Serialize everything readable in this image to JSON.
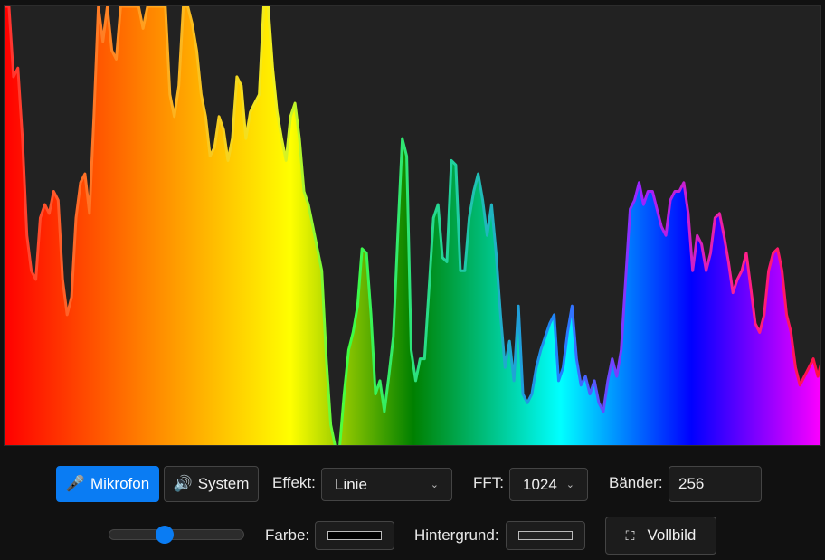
{
  "controls": {
    "mic_label": "Mikrofon",
    "system_label": "System",
    "effect_label": "Effekt:",
    "effect_value": "Linie",
    "fft_label": "FFT:",
    "fft_value": "1024",
    "bands_label": "Bänder:",
    "bands_value": "256",
    "color_label": "Farbe:",
    "background_label": "Hintergrund:",
    "fullscreen_label": "Vollbild",
    "volume_level": 0.4,
    "color_value": "#000000",
    "background_value": "#222222"
  },
  "colors": {
    "accent": "#0a7cf3",
    "panel_bg": "#222222",
    "page_bg": "#111111"
  },
  "spectrum": {
    "max": 100,
    "values": [
      100,
      100,
      84,
      86,
      70,
      48,
      40,
      38,
      52,
      55,
      53,
      58,
      56,
      38,
      30,
      34,
      52,
      60,
      62,
      53,
      75,
      100,
      92,
      100,
      90,
      88,
      100,
      100,
      100,
      100,
      100,
      95,
      100,
      100,
      100,
      100,
      100,
      80,
      75,
      82,
      100,
      100,
      96,
      90,
      80,
      75,
      66,
      68,
      75,
      72,
      65,
      70,
      84,
      82,
      70,
      76,
      78,
      80,
      100,
      100,
      86,
      76,
      70,
      65,
      75,
      78,
      70,
      58,
      55,
      50,
      45,
      40,
      20,
      5,
      0,
      0,
      12,
      22,
      26,
      32,
      45,
      44,
      30,
      12,
      15,
      8,
      16,
      25,
      48,
      70,
      66,
      22,
      15,
      20,
      20,
      36,
      52,
      55,
      43,
      42,
      65,
      64,
      40,
      40,
      52,
      58,
      62,
      56,
      48,
      55,
      44,
      30,
      18,
      24,
      15,
      32,
      12,
      10,
      12,
      18,
      22,
      25,
      28,
      30,
      15,
      18,
      26,
      32,
      20,
      14,
      16,
      12,
      15,
      10,
      8,
      15,
      20,
      16,
      22,
      38,
      54,
      56,
      60,
      55,
      58,
      58,
      54,
      50,
      48,
      56,
      58,
      58,
      60,
      53,
      40,
      48,
      46,
      40,
      44,
      52,
      53,
      48,
      42,
      35,
      38,
      40,
      44,
      36,
      28,
      26,
      30,
      40,
      44,
      45,
      40,
      30,
      26,
      18,
      14,
      16,
      18,
      20,
      16,
      20
    ]
  }
}
